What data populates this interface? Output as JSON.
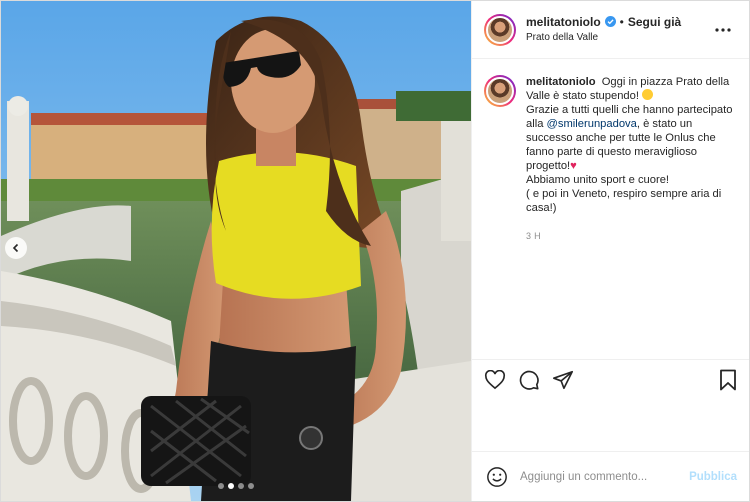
{
  "post": {
    "author": {
      "username": "melitatoniolo",
      "verified": true,
      "follow_label": "Segui già",
      "separator": "•",
      "location": "Prato della Valle"
    },
    "more_icon": "more-horizontal-icon",
    "caption": {
      "username": "melitatoniolo",
      "line1": "Oggi in piazza Prato della Valle è stato stupendo!",
      "line2_prefix": "Grazie a tutti quelli che hanno partecipato alla",
      "mention": "@smilerunpadova",
      "line2_suffix": ", è stato un successo anche per tutte le Onlus che fanno parte di questo meraviglioso progetto!",
      "line3": "Abbiamo unito sport e cuore!",
      "line4": "( e poi in Veneto, respiro sempre aria di casa!)",
      "heart_emoji": "♥",
      "timestamp": "3 h"
    },
    "carousel": {
      "slide_count": 4,
      "current_index": 1
    },
    "actions": {
      "like_icon": "heart-icon",
      "comment_icon": "comment-bubble-icon",
      "share_icon": "paper-plane-icon",
      "save_icon": "bookmark-icon"
    },
    "add_comment": {
      "emoji_icon": "smiley-icon",
      "placeholder": "Aggiungi un commento...",
      "publish_label": "Pubblica"
    },
    "colors": {
      "verified": "#3897f0",
      "publish_disabled": "#b2dffc",
      "mention": "#00376b",
      "top_yellow": "#e9e02a"
    }
  }
}
